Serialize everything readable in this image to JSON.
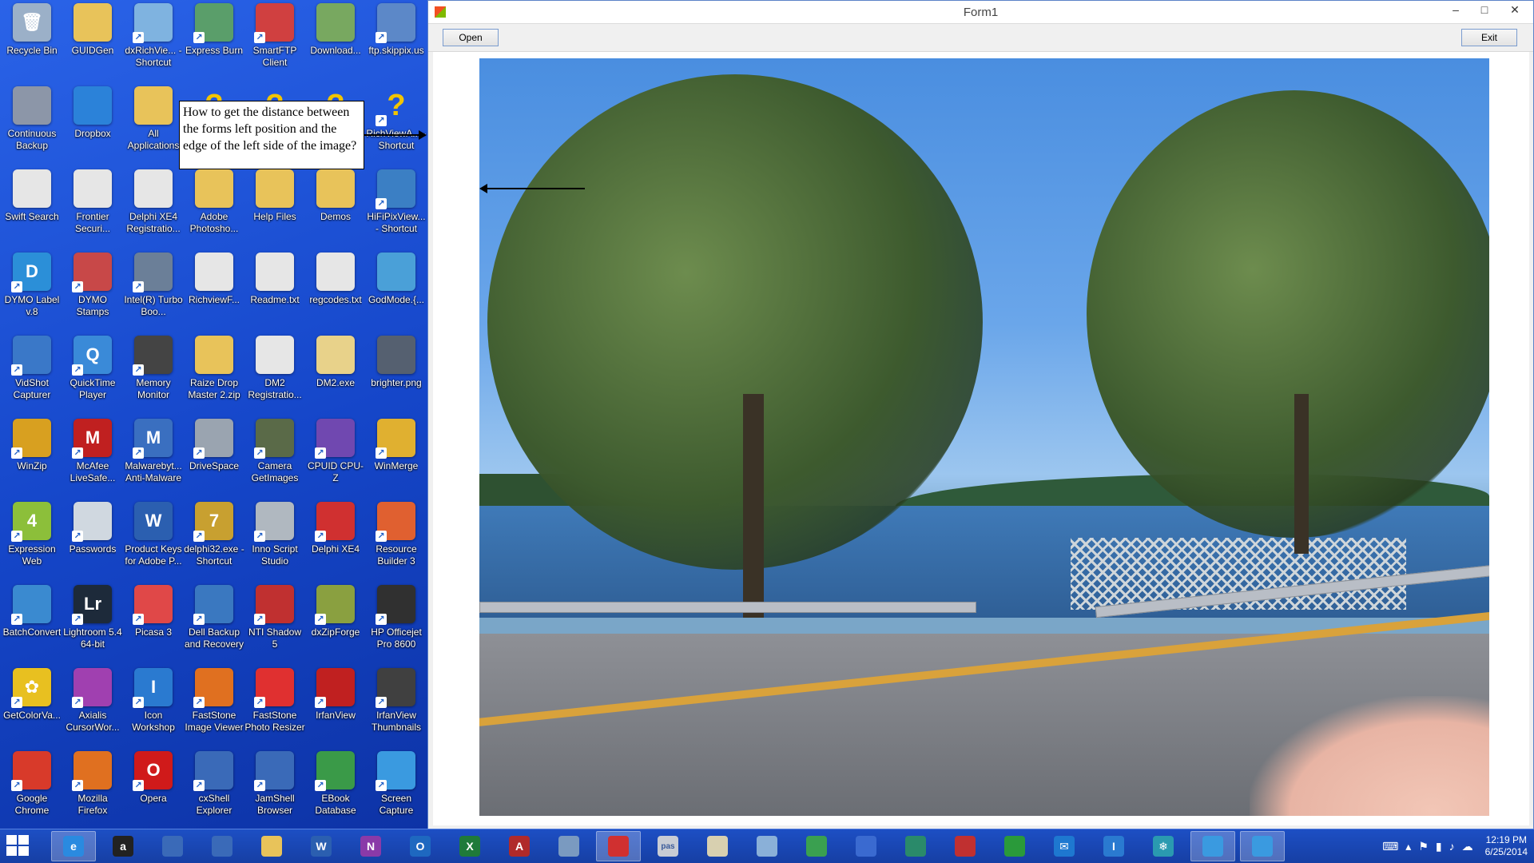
{
  "desktop": {
    "icons": [
      {
        "label": "Recycle Bin",
        "glyph": "recycle-bin-icon",
        "ch": "🗑",
        "color": "#9bb0c8",
        "shortcut": false
      },
      {
        "label": "GUIDGen",
        "glyph": "folder-icon",
        "ch": "",
        "color": "#e8c35a",
        "shortcut": false
      },
      {
        "label": "dxRichVie... - Shortcut",
        "glyph": "document-icon",
        "ch": "",
        "color": "#7fb3e0",
        "shortcut": true
      },
      {
        "label": "Express Burn",
        "glyph": "burn-icon",
        "ch": "",
        "color": "#5a9e6a",
        "shortcut": true
      },
      {
        "label": "SmartFTP Client",
        "glyph": "ftp-icon",
        "ch": "",
        "color": "#d04040",
        "shortcut": true
      },
      {
        "label": "Download...",
        "glyph": "download-icon",
        "ch": "",
        "color": "#78a860",
        "shortcut": false
      },
      {
        "label": "ftp.skippix.us",
        "glyph": "network-icon",
        "ch": "",
        "color": "#5c88c8",
        "shortcut": true
      },
      {
        "label": "Continuous Backup",
        "glyph": "backup-icon",
        "ch": "",
        "color": "#8c96a8",
        "shortcut": false
      },
      {
        "label": "Dropbox",
        "glyph": "dropbox-icon",
        "ch": "",
        "color": "#2b82d9",
        "shortcut": false
      },
      {
        "label": "All Applications",
        "glyph": "folder-icon",
        "ch": "",
        "color": "#e8c35a",
        "shortcut": false
      },
      {
        "label": "",
        "glyph": "unknown-icon",
        "ch": "?",
        "color": "#e5b600",
        "shortcut": false
      },
      {
        "label": "",
        "glyph": "unknown-icon",
        "ch": "?",
        "color": "#e5b600",
        "shortcut": false
      },
      {
        "label": "",
        "glyph": "unknown-icon",
        "ch": "?",
        "color": "#e5b600",
        "shortcut": false
      },
      {
        "label": "RichViewA... - Shortcut",
        "glyph": "unknown-icon",
        "ch": "?",
        "color": "#e5b600",
        "shortcut": true
      },
      {
        "label": "Swift Search",
        "glyph": "file-icon",
        "ch": "",
        "color": "#e6e6e6",
        "shortcut": false
      },
      {
        "label": "Frontier Securi...",
        "glyph": "file-icon",
        "ch": "",
        "color": "#e6e6e6",
        "shortcut": false
      },
      {
        "label": "Delphi XE4 Registratio...",
        "glyph": "file-icon",
        "ch": "",
        "color": "#e6e6e6",
        "shortcut": false
      },
      {
        "label": "Adobe Photosho...",
        "glyph": "folder-icon",
        "ch": "",
        "color": "#e8c35a",
        "shortcut": false
      },
      {
        "label": "Help Files",
        "glyph": "folder-icon",
        "ch": "",
        "color": "#e8c35a",
        "shortcut": false
      },
      {
        "label": "Demos",
        "glyph": "folder-icon",
        "ch": "",
        "color": "#e8c35a",
        "shortcut": false
      },
      {
        "label": "HiFiPixView... - Shortcut",
        "glyph": "hifipix-icon",
        "ch": "",
        "color": "#3b7fc4",
        "shortcut": true
      },
      {
        "label": "DYMO Label v.8",
        "glyph": "dymo-label-icon",
        "ch": "D",
        "color": "#2b8fd8",
        "shortcut": true
      },
      {
        "label": "DYMO Stamps",
        "glyph": "dymo-stamps-icon",
        "ch": "",
        "color": "#c84848",
        "shortcut": true
      },
      {
        "label": "Intel(R) Turbo Boo...",
        "glyph": "monitor-icon",
        "ch": "",
        "color": "#6b7f98",
        "shortcut": true
      },
      {
        "label": "RichviewF...",
        "glyph": "file-icon",
        "ch": "",
        "color": "#e6e6e6",
        "shortcut": false
      },
      {
        "label": "Readme.txt",
        "glyph": "file-icon",
        "ch": "",
        "color": "#e6e6e6",
        "shortcut": false
      },
      {
        "label": "regcodes.txt",
        "glyph": "file-icon",
        "ch": "",
        "color": "#e6e6e6",
        "shortcut": false
      },
      {
        "label": "GodMode.{...",
        "glyph": "control-panel-icon",
        "ch": "",
        "color": "#4aa0d8",
        "shortcut": false
      },
      {
        "label": "VidShot Capturer",
        "glyph": "vidshot-icon",
        "ch": "",
        "color": "#3a78c8",
        "shortcut": true
      },
      {
        "label": "QuickTime Player",
        "glyph": "quicktime-icon",
        "ch": "Q",
        "color": "#3a8ad8",
        "shortcut": true
      },
      {
        "label": "Memory Monitor",
        "glyph": "memory-icon",
        "ch": "",
        "color": "#444444",
        "shortcut": true
      },
      {
        "label": "Raize Drop Master 2.zip",
        "glyph": "zip-icon",
        "ch": "",
        "color": "#e8c35a",
        "shortcut": false
      },
      {
        "label": "DM2 Registratio...",
        "glyph": "file-icon",
        "ch": "",
        "color": "#e6e6e6",
        "shortcut": false
      },
      {
        "label": "DM2.exe",
        "glyph": "exe-icon",
        "ch": "",
        "color": "#e8d28a",
        "shortcut": false
      },
      {
        "label": "brighter.png",
        "glyph": "image-icon",
        "ch": "",
        "color": "#556070",
        "shortcut": false
      },
      {
        "label": "WinZip",
        "glyph": "winzip-icon",
        "ch": "",
        "color": "#d8a020",
        "shortcut": true
      },
      {
        "label": "McAfee LiveSafe...",
        "glyph": "mcafee-icon",
        "ch": "M",
        "color": "#c02020",
        "shortcut": true
      },
      {
        "label": "Malwarebyt... Anti-Malware",
        "glyph": "malwarebytes-icon",
        "ch": "M",
        "color": "#3a6fc0",
        "shortcut": true
      },
      {
        "label": "DriveSpace",
        "glyph": "drive-icon",
        "ch": "",
        "color": "#9aa4b0",
        "shortcut": true
      },
      {
        "label": "Camera GetImages",
        "glyph": "camera-icon",
        "ch": "",
        "color": "#5a6a48",
        "shortcut": true
      },
      {
        "label": "CPUID CPU-Z",
        "glyph": "cpuz-icon",
        "ch": "",
        "color": "#7048b0",
        "shortcut": true
      },
      {
        "label": "WinMerge",
        "glyph": "winmerge-icon",
        "ch": "",
        "color": "#e0b030",
        "shortcut": true
      },
      {
        "label": "Expression Web",
        "glyph": "expression-web-icon",
        "ch": "4",
        "color": "#8cbf3a",
        "shortcut": true
      },
      {
        "label": "Passwords",
        "glyph": "passwords-icon",
        "ch": "",
        "color": "#d0d8e0",
        "shortcut": true
      },
      {
        "label": "Product Keys for Adobe P...",
        "glyph": "word-doc-icon",
        "ch": "W",
        "color": "#2b5fb0",
        "shortcut": false
      },
      {
        "label": "delphi32.exe - Shortcut",
        "glyph": "delphi7-icon",
        "ch": "7",
        "color": "#c8a030",
        "shortcut": true
      },
      {
        "label": "Inno Script Studio",
        "glyph": "inno-icon",
        "ch": "",
        "color": "#b0b8c0",
        "shortcut": true
      },
      {
        "label": "Delphi XE4",
        "glyph": "delphi-icon",
        "ch": "",
        "color": "#d03030",
        "shortcut": true
      },
      {
        "label": "Resource Builder 3",
        "glyph": "cube-icon",
        "ch": "",
        "color": "#e06030",
        "shortcut": true
      },
      {
        "label": "BatchConvert",
        "glyph": "batchconvert-icon",
        "ch": "",
        "color": "#3a8ad0",
        "shortcut": true
      },
      {
        "label": "Lightroom 5.4 64-bit",
        "glyph": "lightroom-icon",
        "ch": "Lr",
        "color": "#1d2a3a",
        "shortcut": true
      },
      {
        "label": "Picasa 3",
        "glyph": "picasa-icon",
        "ch": "",
        "color": "#e04848",
        "shortcut": true
      },
      {
        "label": "Dell Backup and Recovery",
        "glyph": "dell-backup-icon",
        "ch": "",
        "color": "#3a78c0",
        "shortcut": true
      },
      {
        "label": "NTI Shadow 5",
        "glyph": "nti-shadow-icon",
        "ch": "",
        "color": "#c03030",
        "shortcut": true
      },
      {
        "label": "dxZipForge",
        "glyph": "zipforge-icon",
        "ch": "",
        "color": "#8aa040",
        "shortcut": true
      },
      {
        "label": "HP Officejet Pro 8600",
        "glyph": "printer-icon",
        "ch": "",
        "color": "#303030",
        "shortcut": true
      },
      {
        "label": "GetColorVa...",
        "glyph": "flower-icon",
        "ch": "✿",
        "color": "#e8c020",
        "shortcut": true
      },
      {
        "label": "Axialis CursorWor...",
        "glyph": "cursor-icon",
        "ch": "",
        "color": "#a040b0",
        "shortcut": true
      },
      {
        "label": "Icon Workshop",
        "glyph": "icon-workshop-icon",
        "ch": "I",
        "color": "#2a7ad0",
        "shortcut": true
      },
      {
        "label": "FastStone Image Viewer",
        "glyph": "faststone-icon",
        "ch": "",
        "color": "#e07020",
        "shortcut": true
      },
      {
        "label": "FastStone Photo Resizer",
        "glyph": "photo-resizer-icon",
        "ch": "",
        "color": "#e03030",
        "shortcut": true
      },
      {
        "label": "IrfanView",
        "glyph": "irfanview-icon",
        "ch": "",
        "color": "#c02020",
        "shortcut": true
      },
      {
        "label": "IrfanView Thumbnails",
        "glyph": "panda-icon",
        "ch": "",
        "color": "#404040",
        "shortcut": true
      },
      {
        "label": "Google Chrome",
        "glyph": "chrome-icon",
        "ch": "",
        "color": "#d83a2a",
        "shortcut": true
      },
      {
        "label": "Mozilla Firefox",
        "glyph": "firefox-icon",
        "ch": "",
        "color": "#e07020",
        "shortcut": true
      },
      {
        "label": "Opera",
        "glyph": "opera-icon",
        "ch": "O",
        "color": "#d01a1a",
        "shortcut": true
      },
      {
        "label": "cxShell Explorer",
        "glyph": "monitor-icon",
        "ch": "",
        "color": "#3a6ab8",
        "shortcut": true
      },
      {
        "label": "JamShell Browser",
        "glyph": "monitor-icon",
        "ch": "",
        "color": "#3a6ab8",
        "shortcut": true
      },
      {
        "label": "EBook Database",
        "glyph": "ebook-icon",
        "ch": "",
        "color": "#3a9a48",
        "shortcut": true
      },
      {
        "label": "Screen Capture",
        "glyph": "windows-flag-icon",
        "ch": "",
        "color": "#3a9ae0",
        "shortcut": true
      }
    ],
    "callout_text": "How to get the distance between the forms left position and the edge of the left side of the image?"
  },
  "window": {
    "title": "Form1",
    "minimize": "–",
    "maximize": "□",
    "close": "✕",
    "open_label": "Open",
    "exit_label": "Exit"
  },
  "taskbar": {
    "items": [
      {
        "name": "taskbar-internet-explorer",
        "glyph": "internet-explorer-icon",
        "ch": "e",
        "color": "#2a8ae0",
        "active": true
      },
      {
        "name": "taskbar-amazon",
        "glyph": "amazon-icon",
        "ch": "a",
        "color": "#222222",
        "active": false
      },
      {
        "name": "taskbar-cxshell",
        "glyph": "monitor-icon",
        "ch": "",
        "color": "#3a6ab8",
        "active": false
      },
      {
        "name": "taskbar-jamshell",
        "glyph": "monitor-icon",
        "ch": "",
        "color": "#3a6ab8",
        "active": false
      },
      {
        "name": "taskbar-file-explorer",
        "glyph": "folder-icon",
        "ch": "",
        "color": "#e8c35a",
        "active": false
      },
      {
        "name": "taskbar-word",
        "glyph": "word-icon",
        "ch": "W",
        "color": "#2b5fb0",
        "active": false
      },
      {
        "name": "taskbar-onenote",
        "glyph": "onenote-icon",
        "ch": "N",
        "color": "#8a3aa8",
        "active": false
      },
      {
        "name": "taskbar-outlook",
        "glyph": "outlook-icon",
        "ch": "O",
        "color": "#1e68c0",
        "active": false
      },
      {
        "name": "taskbar-excel",
        "glyph": "excel-icon",
        "ch": "X",
        "color": "#1f7a3a",
        "active": false
      },
      {
        "name": "taskbar-access",
        "glyph": "access-icon",
        "ch": "A",
        "color": "#b02a2a",
        "active": false
      },
      {
        "name": "taskbar-calculator",
        "glyph": "calculator-icon",
        "ch": "",
        "color": "#7a9ac0",
        "active": false
      },
      {
        "name": "taskbar-delphi",
        "glyph": "delphi-icon",
        "ch": "",
        "color": "#d03030",
        "active": true
      },
      {
        "name": "taskbar-pas-file",
        "glyph": "pas-file-icon",
        "ch": "pas",
        "color": "#c8ccd4",
        "active": false
      },
      {
        "name": "taskbar-clipboard",
        "glyph": "clipboard-icon",
        "ch": "",
        "color": "#d8d0b0",
        "active": false
      },
      {
        "name": "taskbar-notes",
        "glyph": "notes-icon",
        "ch": "",
        "color": "#8ab0d8",
        "active": false
      },
      {
        "name": "taskbar-globe",
        "glyph": "globe-icon",
        "ch": "",
        "color": "#3aa050",
        "active": false
      },
      {
        "name": "taskbar-book",
        "glyph": "book-icon",
        "ch": "",
        "color": "#3a6ad0",
        "active": false
      },
      {
        "name": "taskbar-photos",
        "glyph": "photos-icon",
        "ch": "",
        "color": "#2a8a6a",
        "active": false
      },
      {
        "name": "taskbar-nti",
        "glyph": "nti-shadow-icon",
        "ch": "",
        "color": "#c03030",
        "active": false
      },
      {
        "name": "taskbar-store",
        "glyph": "store-icon",
        "ch": "",
        "color": "#2a9a3a",
        "active": false
      },
      {
        "name": "taskbar-mail",
        "glyph": "mail-icon",
        "ch": "✉",
        "color": "#1e78d0",
        "active": false
      },
      {
        "name": "taskbar-icon-workshop",
        "glyph": "icon-workshop-icon",
        "ch": "I",
        "color": "#2a7ad0",
        "active": false
      },
      {
        "name": "taskbar-snowflake",
        "glyph": "snowflake-icon",
        "ch": "❄",
        "color": "#2a9ab0",
        "active": false
      },
      {
        "name": "taskbar-windows-app-1",
        "glyph": "windows-flag-icon",
        "ch": "",
        "color": "#3a9ae0",
        "active": true
      },
      {
        "name": "taskbar-windows-app-2",
        "glyph": "windows-flag-icon",
        "ch": "",
        "color": "#3a9ae0",
        "active": true
      }
    ],
    "time": "12:19 PM",
    "date": "6/25/2014"
  }
}
